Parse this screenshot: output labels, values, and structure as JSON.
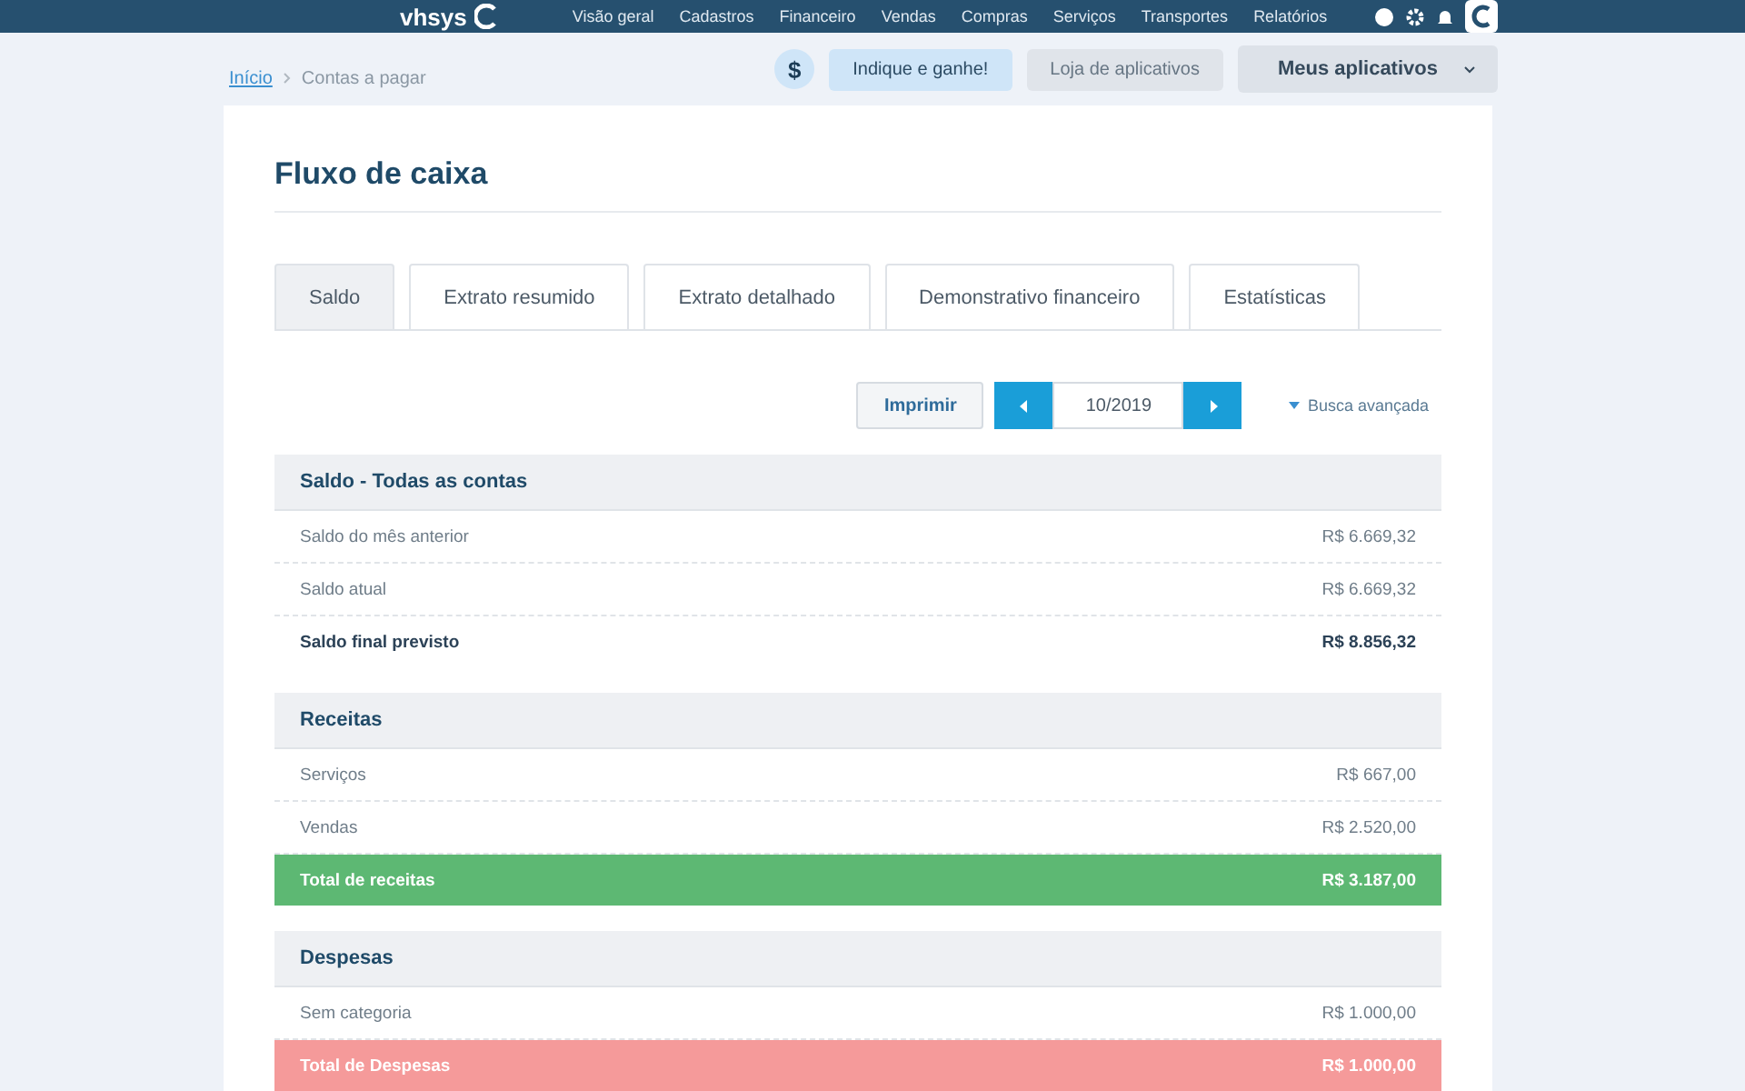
{
  "header": {
    "logo": "vhsys",
    "nav": [
      "Visão geral",
      "Cadastros",
      "Financeiro",
      "Vendas",
      "Compras",
      "Serviços",
      "Transportes",
      "Relatórios"
    ]
  },
  "breadcrumb": [
    {
      "label": "Início",
      "link": true
    },
    {
      "label": "Contas a pagar",
      "link": false
    }
  ],
  "top_actions": {
    "coin_symbol": "$",
    "refer": "Indique e ganhe!",
    "store": "Loja de aplicativos",
    "apps": "Meus aplicativos"
  },
  "page_title": "Fluxo de caixa",
  "tabs": [
    {
      "label": "Saldo",
      "selected": true
    },
    {
      "label": "Extrato resumido",
      "selected": false
    },
    {
      "label": "Extrato detalhado",
      "selected": false
    },
    {
      "label": "Demonstrativo financeiro",
      "selected": false
    },
    {
      "label": "Estatísticas",
      "selected": false
    }
  ],
  "toolbar": {
    "print": "Imprimir",
    "period": "10/2019",
    "advanced_search": "Busca avançada"
  },
  "sections": [
    {
      "title": "Saldo - Todas as contas",
      "rows": [
        {
          "kind": "item",
          "label": "Saldo do mês anterior",
          "value": "R$ 6.669,32"
        },
        {
          "kind": "item",
          "label": "Saldo atual",
          "value": "R$ 6.669,32"
        },
        {
          "kind": "summary",
          "label": "Saldo final previsto",
          "value": "R$ 8.856,32"
        }
      ]
    },
    {
      "title": "Receitas",
      "rows": [
        {
          "kind": "item",
          "label": "Serviços",
          "value": "R$ 667,00"
        },
        {
          "kind": "item",
          "label": "Vendas",
          "value": "R$ 2.520,00"
        },
        {
          "kind": "income-total",
          "label": "Total de receitas",
          "value": "R$ 3.187,00"
        }
      ]
    },
    {
      "title": "Despesas",
      "rows": [
        {
          "kind": "item",
          "label": "Sem categoria",
          "value": "R$ 1.000,00"
        },
        {
          "kind": "expense-total",
          "label": "Total de Despesas",
          "value": "R$ 1.000,00"
        }
      ]
    }
  ]
}
